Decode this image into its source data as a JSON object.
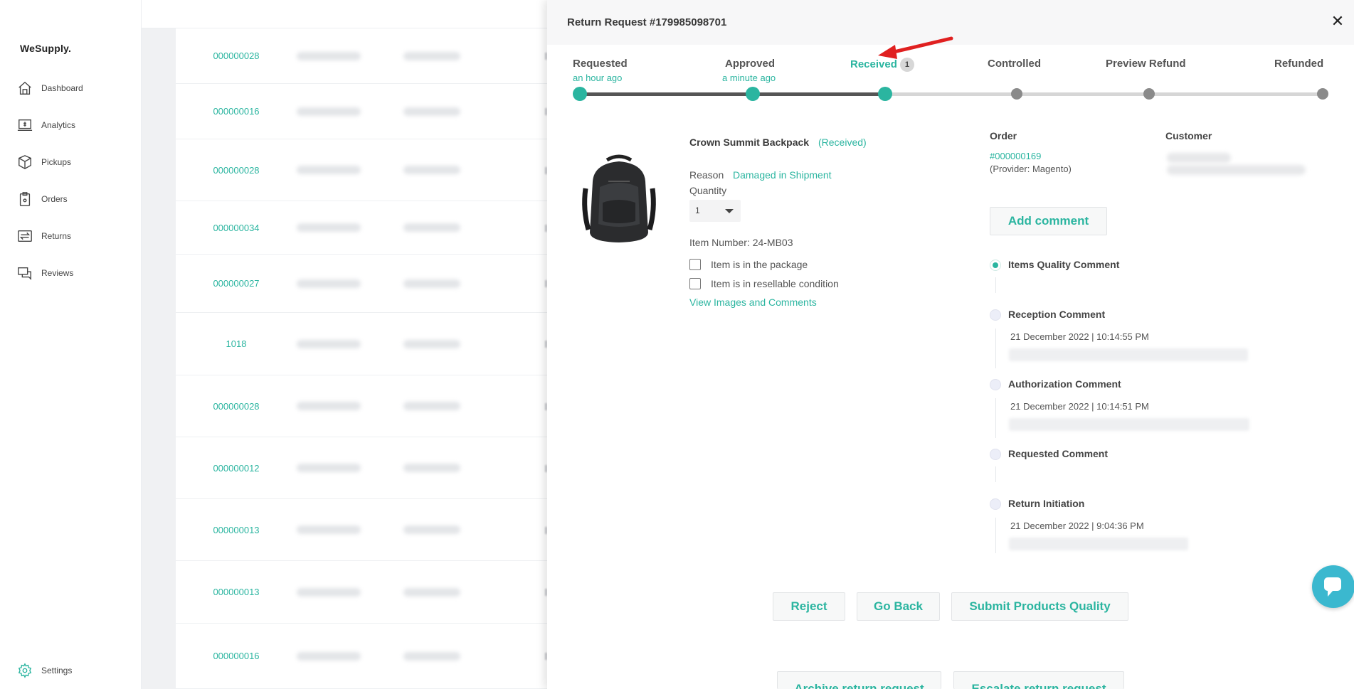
{
  "sidebar": {
    "brand": "WeSupply.",
    "items": [
      {
        "label": "Dashboard",
        "icon": "dashboard-icon"
      },
      {
        "label": "Analytics",
        "icon": "analytics-icon"
      },
      {
        "label": "Pickups",
        "icon": "pickups-icon"
      },
      {
        "label": "Orders",
        "icon": "orders-icon"
      },
      {
        "label": "Returns",
        "icon": "returns-icon"
      },
      {
        "label": "Reviews",
        "icon": "reviews-icon"
      }
    ],
    "settings_label": "Settings"
  },
  "background_table": {
    "order_ids": [
      "000000028",
      "000000016",
      "000000028",
      "000000034",
      "000000027",
      "1018",
      "000000028",
      "000000012",
      "000000013",
      "000000013",
      "000000016"
    ]
  },
  "modal": {
    "title": "Return Request #179985098701",
    "close_glyph": "✕",
    "steps": [
      {
        "label": "Requested",
        "sub": "an hour ago"
      },
      {
        "label": "Approved",
        "sub": "a minute ago"
      },
      {
        "label": "Received",
        "badge": "1"
      },
      {
        "label": "Controlled"
      },
      {
        "label": "Preview Refund"
      },
      {
        "label": "Refunded"
      }
    ],
    "accent_color": "#2bb5a0",
    "product": {
      "name": "Crown Summit Backpack",
      "status": "(Received)",
      "reason_label": "Reason",
      "reason_value": "Damaged in Shipment",
      "quantity_label": "Quantity",
      "quantity_value": "1",
      "item_number": "Item Number: 24-MB03",
      "checkbox_package": "Item is in the package",
      "checkbox_resellable": "Item is in resellable condition",
      "view_link": "View Images and Comments"
    },
    "order": {
      "label": "Order",
      "number": "#000000169",
      "provider": "(Provider: Magento)"
    },
    "customer": {
      "label": "Customer"
    },
    "add_comment": "Add comment",
    "timeline": [
      {
        "title": "Items Quality Comment"
      },
      {
        "title": "Reception Comment",
        "date": "21 December 2022 | 10:14:55 PM"
      },
      {
        "title": "Authorization Comment",
        "date": "21 December 2022 | 10:14:51 PM"
      },
      {
        "title": "Requested Comment"
      },
      {
        "title": "Return Initiation",
        "date": "21 December 2022 | 9:04:36 PM"
      }
    ],
    "actions": {
      "reject": "Reject",
      "go_back": "Go Back",
      "submit": "Submit Products Quality",
      "archive": "Archive return request",
      "escalate": "Escalate return request"
    }
  }
}
